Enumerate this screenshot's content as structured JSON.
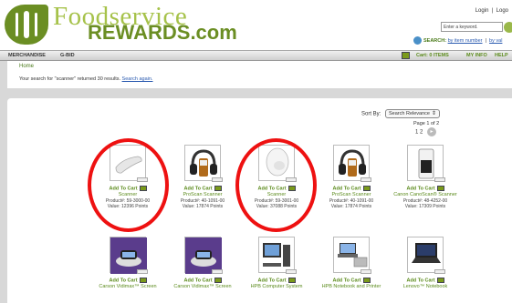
{
  "header": {
    "logo_line1": "Foodservice",
    "logo_line2": "REWARDS.com",
    "login": "Login",
    "logout": "Logo",
    "search_placeholder": "Enter a keyword.",
    "search_label": "SEARCH:",
    "by_item_number": "by item number",
    "by_value": "by val"
  },
  "nav": {
    "merchandise": "MERCHANDISE",
    "gbid": "G-BID",
    "cart": "Cart: 0 ITEMS",
    "my_info": "MY INFO",
    "help": "HELP"
  },
  "breadcrumb": "Home",
  "results": {
    "prefix": "Your search for \"scanner\" returned 30 results. ",
    "search_again": "Search again."
  },
  "sort": {
    "label": "Sort By:",
    "selected": "Search Relevance",
    "page_info": "Page 1 of 2",
    "pages": "1  2"
  },
  "add_to_cart_label": "Add To Cart",
  "products": [
    {
      "name": "Scanner",
      "product_no": "Product#: 59-3000-00",
      "value": "Value: 12396 Points",
      "icon": "handheld-scanner",
      "circled": true
    },
    {
      "name": "ProScan Scanner",
      "product_no": "Product#: 40-1091-00",
      "value": "Value: 17874 Points",
      "icon": "headphone-scanner",
      "circled": false
    },
    {
      "name": "Scanner",
      "product_no": "Product#: 59-3001-00",
      "value": "Value: 37088 Points",
      "icon": "handheld-scanner-white",
      "circled": true
    },
    {
      "name": "ProScan Scanner",
      "product_no": "Product#: 40-1091-00",
      "value": "Value: 17874 Points",
      "icon": "headphone-scanner",
      "circled": false
    },
    {
      "name": "Canon CanoScan® Scanner",
      "product_no": "Product#: 48-4252-00",
      "value": "Value: 17309 Points",
      "icon": "upright-scanner",
      "circled": false
    },
    {
      "name": "Carson Vidimax™ Screen",
      "icon": "magnifier-device"
    },
    {
      "name": "Carson Vidimax™ Screen",
      "icon": "magnifier-device"
    },
    {
      "name": "HPB Computer System",
      "icon": "desktop-computer"
    },
    {
      "name": "HPB Notebook and Printer",
      "icon": "notebook-printer"
    },
    {
      "name": "Lenovo™ Notebook",
      "icon": "laptop"
    }
  ],
  "colors": {
    "brand_green": "#6b8e23",
    "light_green": "#a6c24a",
    "link_blue": "#2a5ab0",
    "circle_red": "#e11111"
  }
}
